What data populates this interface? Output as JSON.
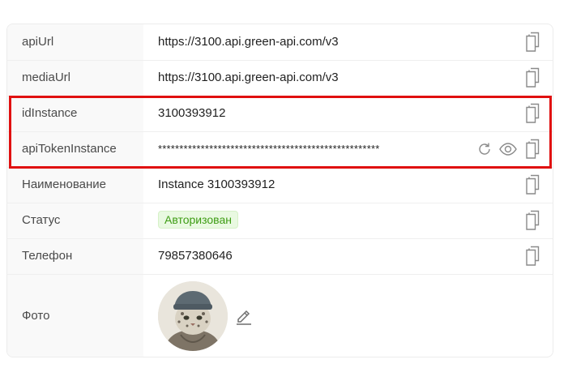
{
  "rows": [
    {
      "label": "apiUrl",
      "value": "https://3100.api.green-api.com/v3"
    },
    {
      "label": "mediaUrl",
      "value": "https://3100.api.green-api.com/v3"
    },
    {
      "label": "idInstance",
      "value": "3100393912"
    },
    {
      "label": "apiTokenInstance",
      "value": "****************************************************"
    },
    {
      "label": "Наименование",
      "value": "Instance 3100393912"
    },
    {
      "label": "Статус",
      "value": "Авторизован"
    },
    {
      "label": "Телефон",
      "value": "79857380646"
    },
    {
      "label": "Фото"
    }
  ],
  "icons": {
    "copy": "copy-icon",
    "refresh": "refresh-icon",
    "show": "eye-icon",
    "edit": "pencil-icon"
  },
  "colors": {
    "highlight": "#e01010",
    "status_bg": "#e9f9e1",
    "status_text": "#3e9d14"
  }
}
